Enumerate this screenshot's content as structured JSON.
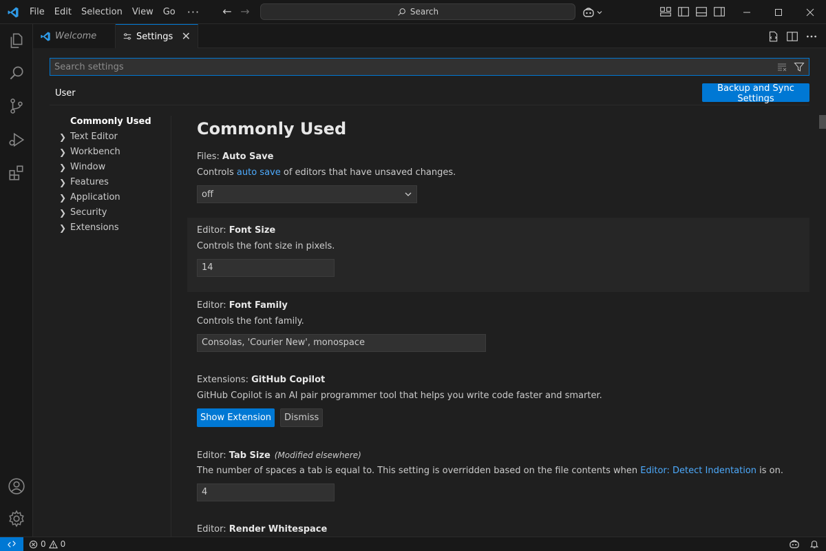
{
  "menu": [
    "File",
    "Edit",
    "Selection",
    "View",
    "Go"
  ],
  "menu_more": "···",
  "command_center": {
    "label": "Search"
  },
  "tabs": [
    {
      "label": "Welcome"
    },
    {
      "label": "Settings",
      "close": "✕"
    }
  ],
  "search": {
    "placeholder": "Search settings",
    "value": ""
  },
  "scope_tab": "User",
  "sync_button": "Backup and Sync Settings",
  "toc": [
    {
      "label": "Commonly Used",
      "current": true
    },
    {
      "label": "Text Editor"
    },
    {
      "label": "Workbench"
    },
    {
      "label": "Window"
    },
    {
      "label": "Features"
    },
    {
      "label": "Application"
    },
    {
      "label": "Security"
    },
    {
      "label": "Extensions"
    }
  ],
  "section_title": "Commonly Used",
  "settings": {
    "auto_save": {
      "category": "Files: ",
      "name": "Auto Save",
      "desc_before": "Controls ",
      "desc_link": "auto save",
      "desc_after": " of editors that have unsaved changes.",
      "value": "off"
    },
    "font_size": {
      "category": "Editor: ",
      "name": "Font Size",
      "desc": "Controls the font size in pixels.",
      "value": "14"
    },
    "font_family": {
      "category": "Editor: ",
      "name": "Font Family",
      "desc": "Controls the font family.",
      "value": "Consolas, 'Courier New', monospace"
    },
    "copilot": {
      "category": "Extensions: ",
      "name": "GitHub Copilot",
      "desc": "GitHub Copilot is an AI pair programmer tool that helps you write code faster and smarter.",
      "primary_button": "Show Extension",
      "secondary_button": "Dismiss"
    },
    "tab_size": {
      "category": "Editor: ",
      "name": "Tab Size",
      "modified": "(Modified elsewhere)",
      "desc_before": "The number of spaces a tab is equal to. This setting is overridden based on the file contents when ",
      "desc_link": "Editor: Detect Indentation",
      "desc_after": " is on.",
      "value": "4"
    },
    "render_whitespace": {
      "category": "Editor: ",
      "name": "Render Whitespace"
    }
  },
  "status": {
    "errors": "0",
    "warnings": "0"
  },
  "colors": {
    "accent": "#0078d4",
    "link": "#4daafc",
    "background": "#1f1f1f"
  }
}
